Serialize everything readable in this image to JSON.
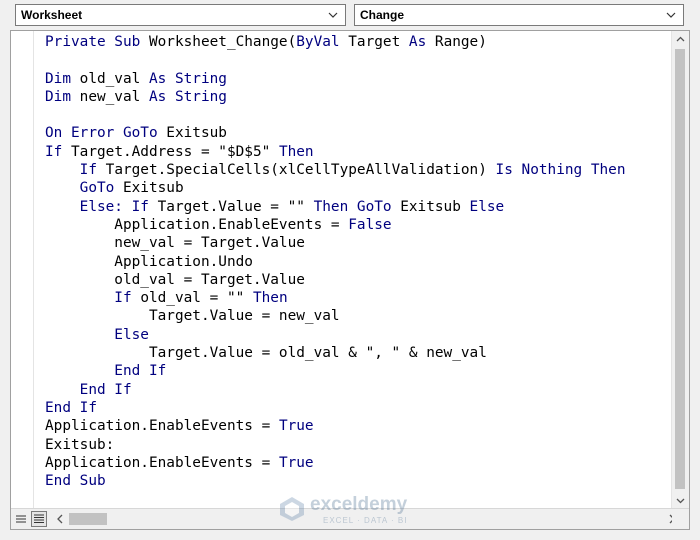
{
  "object_dropdown": {
    "value": "Worksheet"
  },
  "procedure_dropdown": {
    "value": "Change"
  },
  "code_lines": [
    [
      {
        "t": "Private Sub ",
        "k": 1
      },
      {
        "t": "Worksheet_Change(",
        "k": 0
      },
      {
        "t": "ByVal ",
        "k": 1
      },
      {
        "t": "Target ",
        "k": 0
      },
      {
        "t": "As ",
        "k": 1
      },
      {
        "t": "Range)",
        "k": 0
      }
    ],
    [],
    [
      {
        "t": "Dim ",
        "k": 1
      },
      {
        "t": "old_val ",
        "k": 0
      },
      {
        "t": "As ",
        "k": 1
      },
      {
        "t": "String",
        "k": 1
      }
    ],
    [
      {
        "t": "Dim ",
        "k": 1
      },
      {
        "t": "new_val ",
        "k": 0
      },
      {
        "t": "As ",
        "k": 1
      },
      {
        "t": "String",
        "k": 1
      }
    ],
    [],
    [
      {
        "t": "On Error GoTo ",
        "k": 1
      },
      {
        "t": "Exitsub",
        "k": 0
      }
    ],
    [
      {
        "t": "If ",
        "k": 1
      },
      {
        "t": "Target.Address = \"$D$5\" ",
        "k": 0
      },
      {
        "t": "Then",
        "k": 1
      }
    ],
    [
      {
        "t": "    If ",
        "k": 1
      },
      {
        "t": "Target.SpecialCells(xlCellTypeAllValidation) ",
        "k": 0
      },
      {
        "t": "Is Nothing Then",
        "k": 1
      }
    ],
    [
      {
        "t": "    GoTo ",
        "k": 1
      },
      {
        "t": "Exitsub",
        "k": 0
      }
    ],
    [
      {
        "t": "    Else: If ",
        "k": 1
      },
      {
        "t": "Target.Value = \"\" ",
        "k": 0
      },
      {
        "t": "Then GoTo ",
        "k": 1
      },
      {
        "t": "Exitsub ",
        "k": 0
      },
      {
        "t": "Else",
        "k": 1
      }
    ],
    [
      {
        "t": "        Application.EnableEvents = ",
        "k": 0
      },
      {
        "t": "False",
        "k": 1
      }
    ],
    [
      {
        "t": "        new_val = Target.Value",
        "k": 0
      }
    ],
    [
      {
        "t": "        Application.Undo",
        "k": 0
      }
    ],
    [
      {
        "t": "        old_val = Target.Value",
        "k": 0
      }
    ],
    [
      {
        "t": "        If ",
        "k": 1
      },
      {
        "t": "old_val = \"\" ",
        "k": 0
      },
      {
        "t": "Then",
        "k": 1
      }
    ],
    [
      {
        "t": "            Target.Value = new_val",
        "k": 0
      }
    ],
    [
      {
        "t": "        Else",
        "k": 1
      }
    ],
    [
      {
        "t": "            Target.Value = old_val & \", \" & new_val",
        "k": 0
      }
    ],
    [
      {
        "t": "        End If",
        "k": 1
      }
    ],
    [
      {
        "t": "    End If",
        "k": 1
      }
    ],
    [
      {
        "t": "End If",
        "k": 1
      }
    ],
    [
      {
        "t": "Application.EnableEvents = ",
        "k": 0
      },
      {
        "t": "True",
        "k": 1
      }
    ],
    [
      {
        "t": "Exitsub:",
        "k": 0
      }
    ],
    [
      {
        "t": "Application.EnableEvents = ",
        "k": 0
      },
      {
        "t": "True",
        "k": 1
      }
    ],
    [
      {
        "t": "End Sub",
        "k": 1
      }
    ]
  ],
  "watermark": {
    "brand": "exceldemy",
    "tagline": "EXCEL · DATA · BI"
  },
  "colors": {
    "keyword": "#00007f",
    "text": "#000000",
    "background": "#ffffff"
  },
  "icons": {
    "dropdown": "chevron-down-icon",
    "procedure_view": "procedure-view-icon",
    "full_module_view": "full-module-view-icon"
  }
}
